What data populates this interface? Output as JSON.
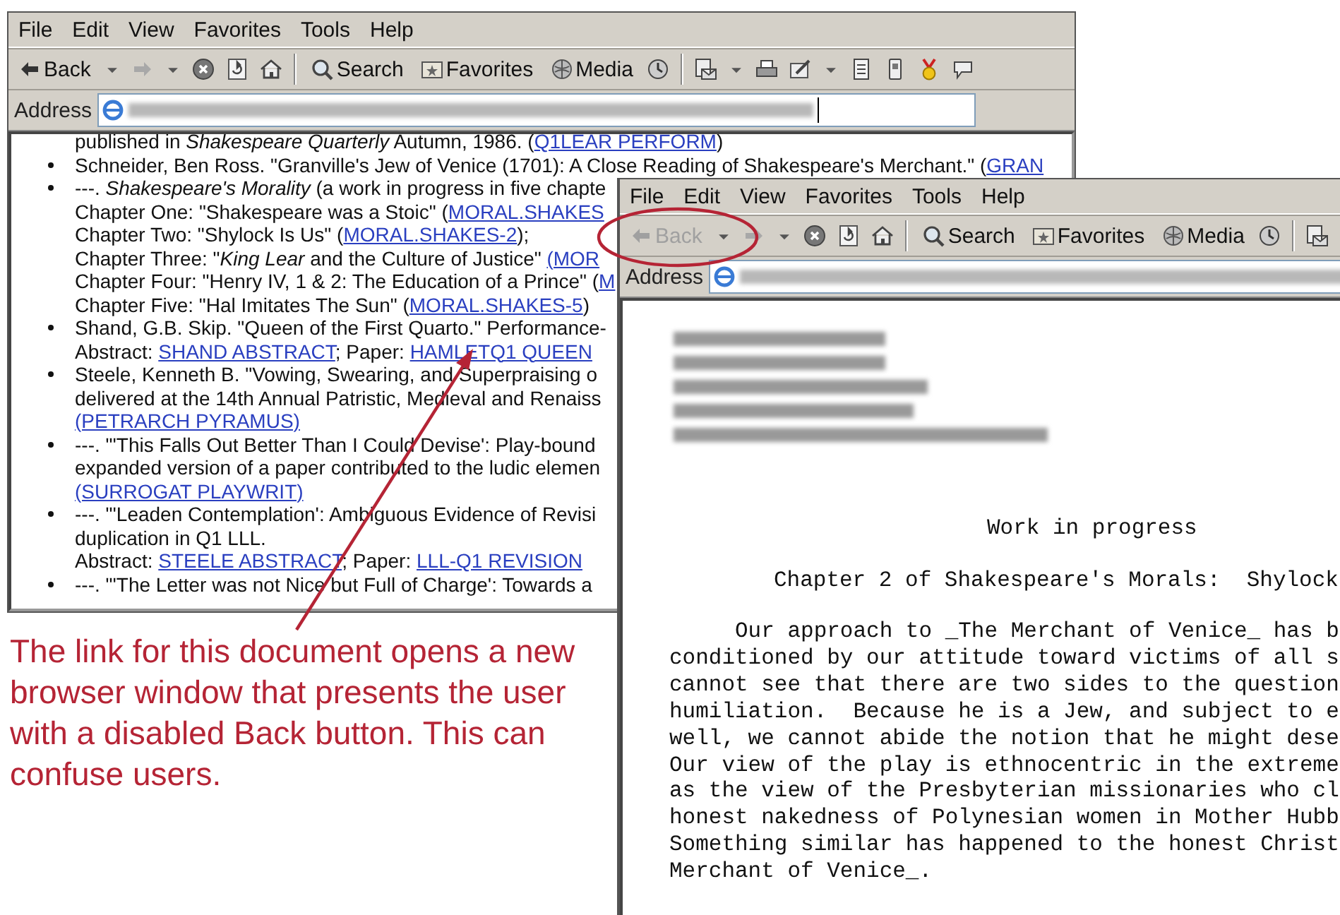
{
  "windows": [
    {
      "menu": [
        "File",
        "Edit",
        "View",
        "Favorites",
        "Tools",
        "Help"
      ],
      "toolbar": [
        {
          "kind": "back",
          "label": "Back",
          "disabled": false
        },
        {
          "kind": "caret"
        },
        {
          "kind": "forward",
          "disabled": true
        },
        {
          "kind": "caret"
        },
        {
          "kind": "stop"
        },
        {
          "kind": "refresh"
        },
        {
          "kind": "home"
        },
        {
          "kind": "sep"
        },
        {
          "kind": "search",
          "label": "Search"
        },
        {
          "kind": "favorites",
          "label": "Favorites"
        },
        {
          "kind": "media",
          "label": "Media"
        },
        {
          "kind": "history"
        },
        {
          "kind": "sep"
        },
        {
          "kind": "mail"
        },
        {
          "kind": "caret"
        },
        {
          "kind": "print"
        },
        {
          "kind": "edit"
        },
        {
          "kind": "caret"
        },
        {
          "kind": "doc"
        },
        {
          "kind": "phone"
        },
        {
          "kind": "badge"
        },
        {
          "kind": "chat"
        }
      ],
      "address_label": "Address",
      "references": [
        {
          "bullet": false,
          "segments": [
            {
              "kind": "text",
              "text": "published in "
            },
            {
              "kind": "italic",
              "text": "Shakespeare Quarterly"
            },
            {
              "kind": "text",
              "text": " Autumn, 1986. ("
            },
            {
              "kind": "link",
              "text": "Q1LEAR PERFORM"
            },
            {
              "kind": "text",
              "text": ")"
            }
          ]
        },
        {
          "bullet": true,
          "segments": [
            {
              "kind": "text",
              "text": "Schneider, Ben Ross. \"Granville's Jew of Venice (1701): A Close Reading of Shakespeare's Merchant.\" ("
            },
            {
              "kind": "link",
              "text": "GRAN"
            }
          ]
        },
        {
          "bullet": true,
          "segments": [
            {
              "kind": "text",
              "text": "---. "
            },
            {
              "kind": "italic",
              "text": "Shakespeare's Morality"
            },
            {
              "kind": "text",
              "text": " (a work in progress in five chapte"
            }
          ]
        },
        {
          "bullet": false,
          "segments": [
            {
              "kind": "text",
              "text": "Chapter One: \"Shakespeare was a Stoic\" ("
            },
            {
              "kind": "link",
              "text": "MORAL.SHAKES"
            }
          ]
        },
        {
          "bullet": false,
          "segments": [
            {
              "kind": "text",
              "text": "Chapter Two: \"Shylock Is Us\" ("
            },
            {
              "kind": "link",
              "text": "MORAL.SHAKES-2"
            },
            {
              "kind": "text",
              "text": ");"
            }
          ]
        },
        {
          "bullet": false,
          "segments": [
            {
              "kind": "text",
              "text": "Chapter Three: \""
            },
            {
              "kind": "italic",
              "text": "King Lear"
            },
            {
              "kind": "text",
              "text": " and the Culture of Justice\" "
            },
            {
              "kind": "link",
              "text": "(MOR"
            }
          ]
        },
        {
          "bullet": false,
          "segments": [
            {
              "kind": "text",
              "text": "Chapter Four: \"Henry IV, 1 & 2: The Education of a Prince\" ("
            },
            {
              "kind": "link",
              "text": "M"
            }
          ]
        },
        {
          "bullet": false,
          "segments": [
            {
              "kind": "text",
              "text": "Chapter Five: \"Hal Imitates The Sun\" ("
            },
            {
              "kind": "link",
              "text": "MORAL.SHAKES-5"
            },
            {
              "kind": "text",
              "text": ")"
            }
          ]
        },
        {
          "bullet": true,
          "segments": [
            {
              "kind": "text",
              "text": "Shand, G.B. Skip. \"Queen of the First Quarto.\" Performance-"
            }
          ]
        },
        {
          "bullet": false,
          "segments": [
            {
              "kind": "text",
              "text": "Abstract: "
            },
            {
              "kind": "link",
              "text": "SHAND ABSTRACT"
            },
            {
              "kind": "text",
              "text": "; Paper: "
            },
            {
              "kind": "link",
              "text": "HAMLETQ1 QUEEN"
            }
          ]
        },
        {
          "bullet": true,
          "segments": [
            {
              "kind": "text",
              "text": "Steele, Kenneth B. \"Vowing, Swearing, and Superpraising o"
            }
          ]
        },
        {
          "bullet": false,
          "segments": [
            {
              "kind": "text",
              "text": "delivered at the 14th Annual Patristic, Medieval and Renaiss"
            }
          ]
        },
        {
          "bullet": false,
          "segments": [
            {
              "kind": "link",
              "text": "(PETRARCH PYRAMUS)"
            }
          ]
        },
        {
          "bullet": true,
          "segments": [
            {
              "kind": "text",
              "text": "---. \"'This Falls Out Better Than I Could Devise': Play-bound"
            }
          ]
        },
        {
          "bullet": false,
          "segments": [
            {
              "kind": "text",
              "text": "expanded version of a paper contributed to the ludic elemen"
            }
          ]
        },
        {
          "bullet": false,
          "segments": [
            {
              "kind": "link",
              "text": "(SURROGAT PLAYWRIT)"
            }
          ]
        },
        {
          "bullet": true,
          "segments": [
            {
              "kind": "text",
              "text": "---. \"'Leaden Contemplation': Ambiguous Evidence of Revisi"
            }
          ]
        },
        {
          "bullet": false,
          "segments": [
            {
              "kind": "text",
              "text": "duplication in Q1 LLL."
            }
          ]
        },
        {
          "bullet": false,
          "segments": [
            {
              "kind": "text",
              "text": "Abstract: "
            },
            {
              "kind": "link",
              "text": "STEELE ABSTRACT"
            },
            {
              "kind": "text",
              "text": "; Paper: "
            },
            {
              "kind": "link",
              "text": "LLL-Q1 REVISION"
            }
          ]
        },
        {
          "bullet": true,
          "segments": [
            {
              "kind": "text",
              "text": "---. \"'The Letter was not Nice but Full of Charge': Towards a"
            }
          ]
        }
      ]
    },
    {
      "menu": [
        "File",
        "Edit",
        "View",
        "Favorites",
        "Tools",
        "Help"
      ],
      "toolbar": [
        {
          "kind": "back",
          "label": "Back",
          "disabled": true
        },
        {
          "kind": "caret"
        },
        {
          "kind": "forward",
          "disabled": true
        },
        {
          "kind": "caret"
        },
        {
          "kind": "stop"
        },
        {
          "kind": "refresh"
        },
        {
          "kind": "home"
        },
        {
          "kind": "sep"
        },
        {
          "kind": "search",
          "label": "Search"
        },
        {
          "kind": "favorites",
          "label": "Favorites"
        },
        {
          "kind": "media",
          "label": "Media"
        },
        {
          "kind": "history"
        },
        {
          "kind": "sep"
        },
        {
          "kind": "mail"
        }
      ],
      "address_label": "Address",
      "heading": "Work in progress",
      "subheading": "Chapter 2 of Shakespeare's Morals:  Shylock",
      "paragraph": [
        "     Our approach to _The Merchant of Venice_ has b",
        "conditioned by our attitude toward victims of all s",
        "cannot see that there are two sides to the question",
        "humiliation.  Because he is a Jew, and subject to e",
        "well, we cannot abide the notion that he might dese",
        "Our view of the play is ethnocentric in the extreme",
        "as the view of the Presbyterian missionaries who cl",
        "honest nakedness of Polynesian women in Mother Hubb",
        "Something similar has happened to the honest Christ",
        "Merchant of Venice_."
      ]
    }
  ],
  "callout": "The link for this document opens a new browser window that presents the user with a disabled Back button. This can confuse users."
}
